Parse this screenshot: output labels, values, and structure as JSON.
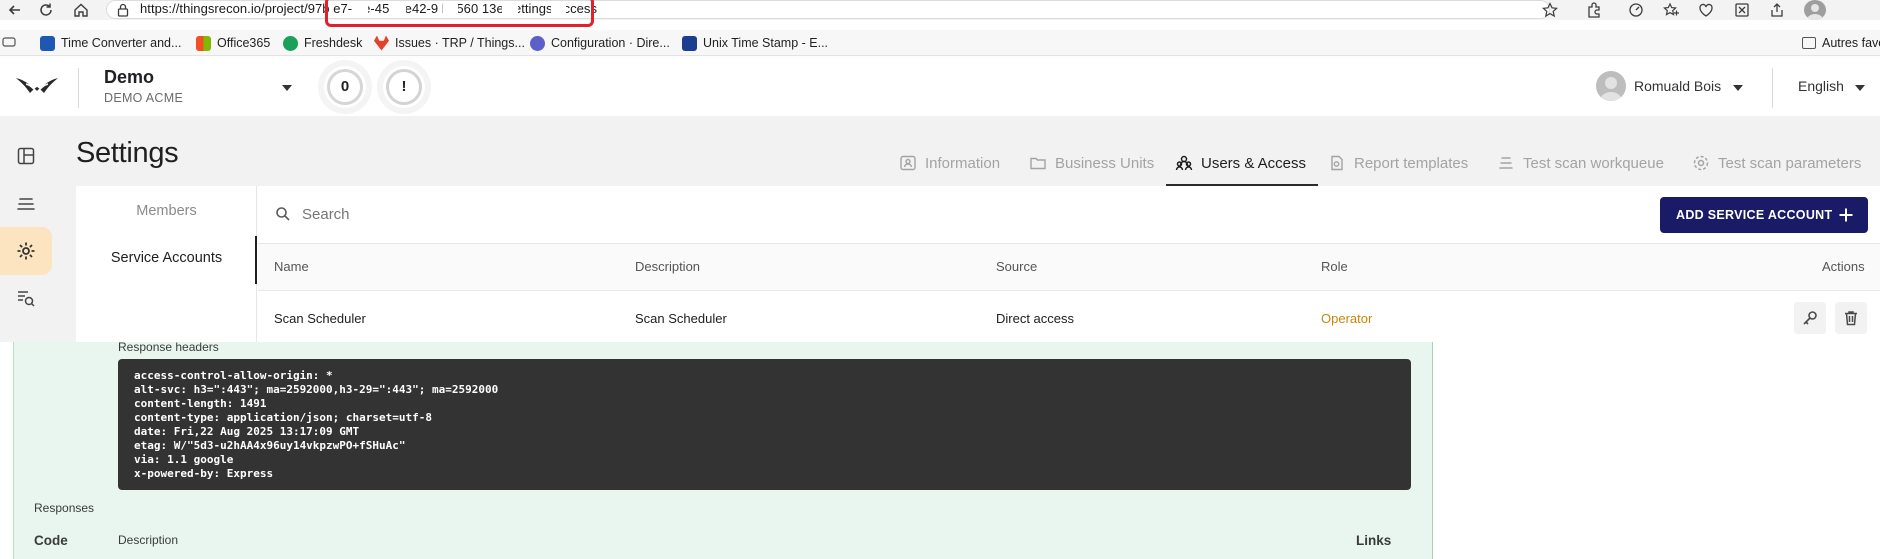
{
  "browser": {
    "url": "https://thingsrecon.io/project/97b██e7-██3e-45██-be42-9██b2560███13e/settings/access",
    "url_visible": "https://thingsrecon.io/project/97b  e7-  3e-45  -be42-9  b2560  13e/settings/access",
    "bookmarks": [
      {
        "label": "Time Converter and...",
        "icon": "time-converter-icon",
        "color": "#1f57b5"
      },
      {
        "label": "Office365",
        "icon": "office365-icon",
        "color": "#e04a1f"
      },
      {
        "label": "Freshdesk",
        "icon": "freshdesk-icon",
        "color": "#1aa05a"
      },
      {
        "label": "Issues · TRP / Things...",
        "icon": "gitlab-icon",
        "color": "#e2432a"
      },
      {
        "label": "Configuration · Dire...",
        "icon": "configuration-icon",
        "color": "#5b5fc7"
      },
      {
        "label": "Unix Time Stamp - E...",
        "icon": "unix-timestamp-icon",
        "color": "#1d3d8f"
      }
    ],
    "other_favorites": "Autres favo"
  },
  "header": {
    "org_name": "Demo",
    "org_sub": "DEMO ACME",
    "counter_value": "0",
    "alert_symbol": "!",
    "user_name": "Romuald Bois",
    "language": "English"
  },
  "sidebar": {
    "items": [
      {
        "icon": "dashboard-icon",
        "active": false
      },
      {
        "icon": "layers-icon",
        "active": false
      },
      {
        "icon": "settings-icon",
        "active": true
      },
      {
        "icon": "search-list-icon",
        "active": false
      }
    ]
  },
  "page": {
    "title": "Settings",
    "tabs": [
      {
        "label": "Information",
        "icon": "id-card-icon",
        "active": false
      },
      {
        "label": "Business Units",
        "icon": "folder-icon",
        "active": false
      },
      {
        "label": "Users & Access",
        "icon": "users-icon",
        "active": true
      },
      {
        "label": "Report templates",
        "icon": "report-icon",
        "active": false
      },
      {
        "label": "Test scan workqueue",
        "icon": "queue-icon",
        "active": false
      },
      {
        "label": "Test scan parameters",
        "icon": "gear-icon",
        "active": false
      }
    ]
  },
  "access": {
    "subnav": [
      {
        "label": "Members",
        "active": false
      },
      {
        "label": "Service Accounts",
        "active": true
      }
    ],
    "search_placeholder": "Search",
    "add_button_label": "ADD SERVICE ACCOUNT",
    "columns": [
      "Name",
      "Description",
      "Source",
      "Role",
      "Actions"
    ],
    "rows": [
      {
        "name": "Scan Scheduler",
        "description": "Scan Scheduler",
        "source": "Direct access",
        "role": "Operator"
      }
    ],
    "colors": {
      "accent": "#1a1b66",
      "role": "#c8870a",
      "active_nav": "#fbe4bf"
    }
  },
  "overlay": {
    "response_headers_label": "Response headers",
    "headers": [
      "access-control-allow-origin: *",
      "alt-svc: h3=\":443\"; ma=2592000,h3-29=\":443\"; ma=2592000",
      "content-length: 1491",
      "content-type: application/json; charset=utf-8",
      "date: Fri,22 Aug 2025 13:17:09 GMT",
      "etag: W/\"5d3-u2hAA4x96uy14vkpzwPO+fSHuAc\"",
      "via: 1.1 google",
      "x-powered-by: Express"
    ],
    "responses_label": "Responses",
    "columns": {
      "code": "Code",
      "description": "Description",
      "links": "Links"
    },
    "background": "#e8f6ef"
  }
}
